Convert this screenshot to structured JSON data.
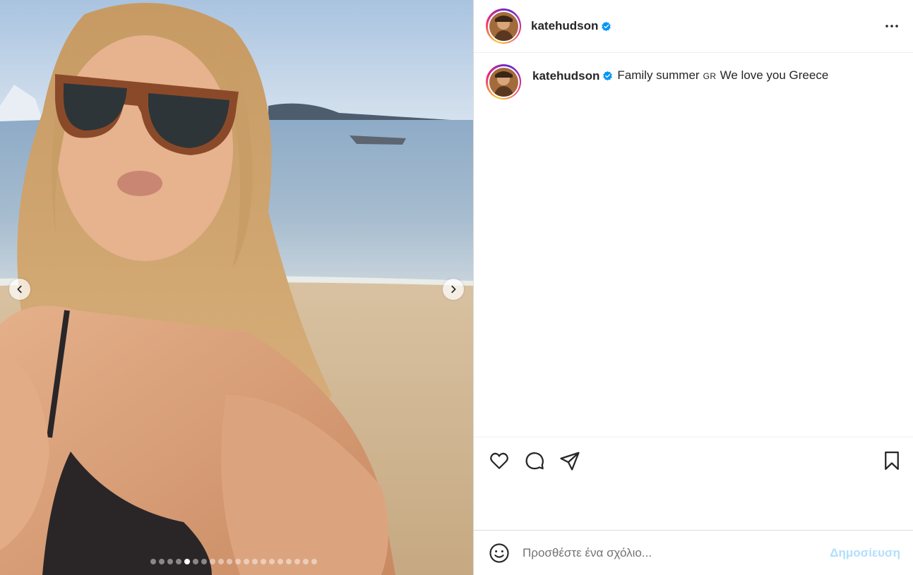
{
  "post": {
    "image_alt": "Selfie at the beach wearing sunglasses",
    "carousel": {
      "total": 20,
      "active_index": 4
    }
  },
  "header": {
    "username": "katehudson",
    "verified": true
  },
  "caption": {
    "username": "katehudson",
    "text_before": "Family summer",
    "flag": "GR",
    "text_after": "We love you Greece"
  },
  "icons": {
    "like": "heart-icon",
    "comment": "comment-icon",
    "share": "send-icon",
    "save": "bookmark-icon",
    "emoji": "emoji-icon",
    "more": "more-options-icon",
    "verified": "verified-badge-icon"
  },
  "comment_box": {
    "placeholder": "Προσθέστε ένα σχόλιο...",
    "post_label": "Δημοσίευση"
  },
  "colors": {
    "verified_blue": "#0095f6",
    "post_button_disabled": "#b2dffc"
  }
}
